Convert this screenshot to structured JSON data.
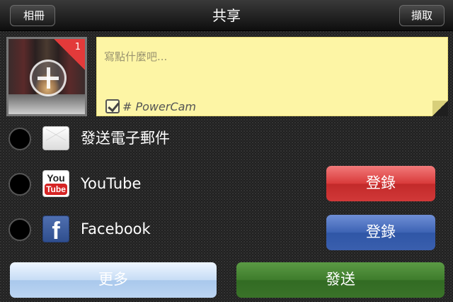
{
  "navbar": {
    "title": "共享",
    "back_label": "相冊",
    "capture_label": "擷取"
  },
  "photo": {
    "count": "1"
  },
  "note": {
    "placeholder": "寫點什麼吧...",
    "tag": "# PowerCam",
    "tag_checked": true
  },
  "services": [
    {
      "label": "發送電子郵件",
      "icon": "mail-icon",
      "selected": false
    },
    {
      "label": "YouTube",
      "icon": "youtube-icon",
      "selected": false,
      "login_label": "登錄",
      "login_color": "#d93a3a",
      "icon_text_top": "You",
      "icon_text_bottom": "Tube"
    },
    {
      "label": "Facebook",
      "icon": "facebook-icon",
      "selected": false,
      "login_label": "登錄",
      "login_color": "#3d63b4",
      "icon_text": "f"
    }
  ],
  "footer": {
    "more_label": "更多",
    "send_label": "發送"
  },
  "colors": {
    "send": "#3e7c2c",
    "more": "#c7ddf5",
    "note_bg": "#fdf5a5"
  }
}
